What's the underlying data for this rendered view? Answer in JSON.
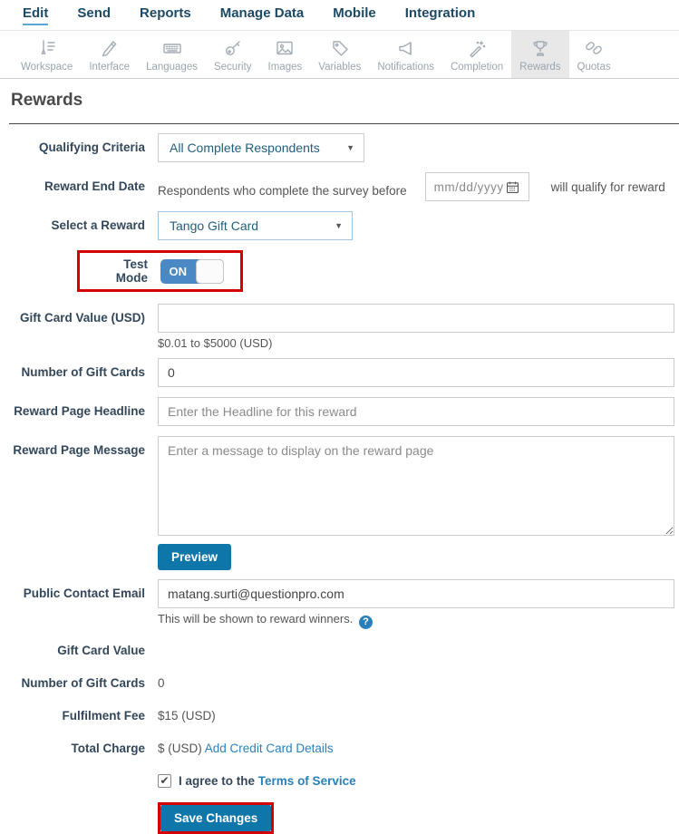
{
  "nav": {
    "items": [
      {
        "label": "Edit",
        "active": true
      },
      {
        "label": "Send",
        "active": false
      },
      {
        "label": "Reports",
        "active": false
      },
      {
        "label": "Manage Data",
        "active": false
      },
      {
        "label": "Mobile",
        "active": false
      },
      {
        "label": "Integration",
        "active": false
      }
    ]
  },
  "toolbar": {
    "active_tab": "Rewards",
    "tabs": [
      {
        "label": "Workspace"
      },
      {
        "label": "Interface"
      },
      {
        "label": "Languages"
      },
      {
        "label": "Security"
      },
      {
        "label": "Images"
      },
      {
        "label": "Variables"
      },
      {
        "label": "Notifications"
      },
      {
        "label": "Completion"
      },
      {
        "label": "Rewards"
      },
      {
        "label": "Quotas"
      }
    ]
  },
  "page": {
    "title": "Rewards"
  },
  "form": {
    "qualifying_criteria": {
      "label": "Qualifying Criteria",
      "value": "All Complete Respondents"
    },
    "reward_end_date": {
      "label": "Reward End Date",
      "prefix": "Respondents who complete the survey before",
      "placeholder": "mm/dd/yyyy",
      "suffix": "will qualify for reward"
    },
    "select_reward": {
      "label": "Select a Reward",
      "value": "Tango Gift Card"
    },
    "test_mode": {
      "label": "Test Mode",
      "state": "ON"
    },
    "gift_card_value": {
      "label": "Gift Card Value (USD)",
      "value": "",
      "hint": "$0.01 to $5000 (USD)"
    },
    "num_gift_cards": {
      "label": "Number of Gift Cards",
      "value": "0"
    },
    "headline": {
      "label": "Reward Page Headline",
      "placeholder": "Enter the Headline for this reward"
    },
    "message": {
      "label": "Reward Page Message",
      "placeholder": "Enter a message to display on the reward page"
    },
    "preview_label": "Preview",
    "contact_email": {
      "label": "Public Contact Email",
      "value": "matang.surti@questionpro.com",
      "hint": "This will be shown to reward winners."
    },
    "summary": [
      {
        "label": "Gift Card Value",
        "value": ""
      },
      {
        "label": "Number of Gift Cards",
        "value": "0"
      },
      {
        "label": "Fulfilment Fee",
        "value": "$15 (USD)"
      },
      {
        "label": "Total Charge",
        "value": "$ (USD)",
        "link": "Add Credit Card Details"
      }
    ],
    "agree": {
      "checked": true,
      "text": "I agree to the",
      "link": "Terms of Service"
    },
    "save_label": "Save Changes"
  },
  "icons": {
    "dropdown_arrow": "▼",
    "check": "✔",
    "help": "?"
  },
  "colors": {
    "nav_text": "#1c4966",
    "button_blue": "#0e76a8",
    "toggle_blue": "#4a89c4",
    "link_blue": "#2980b9",
    "highlight_red": "#d40000",
    "active_tab_bg": "#e8e8e8"
  }
}
